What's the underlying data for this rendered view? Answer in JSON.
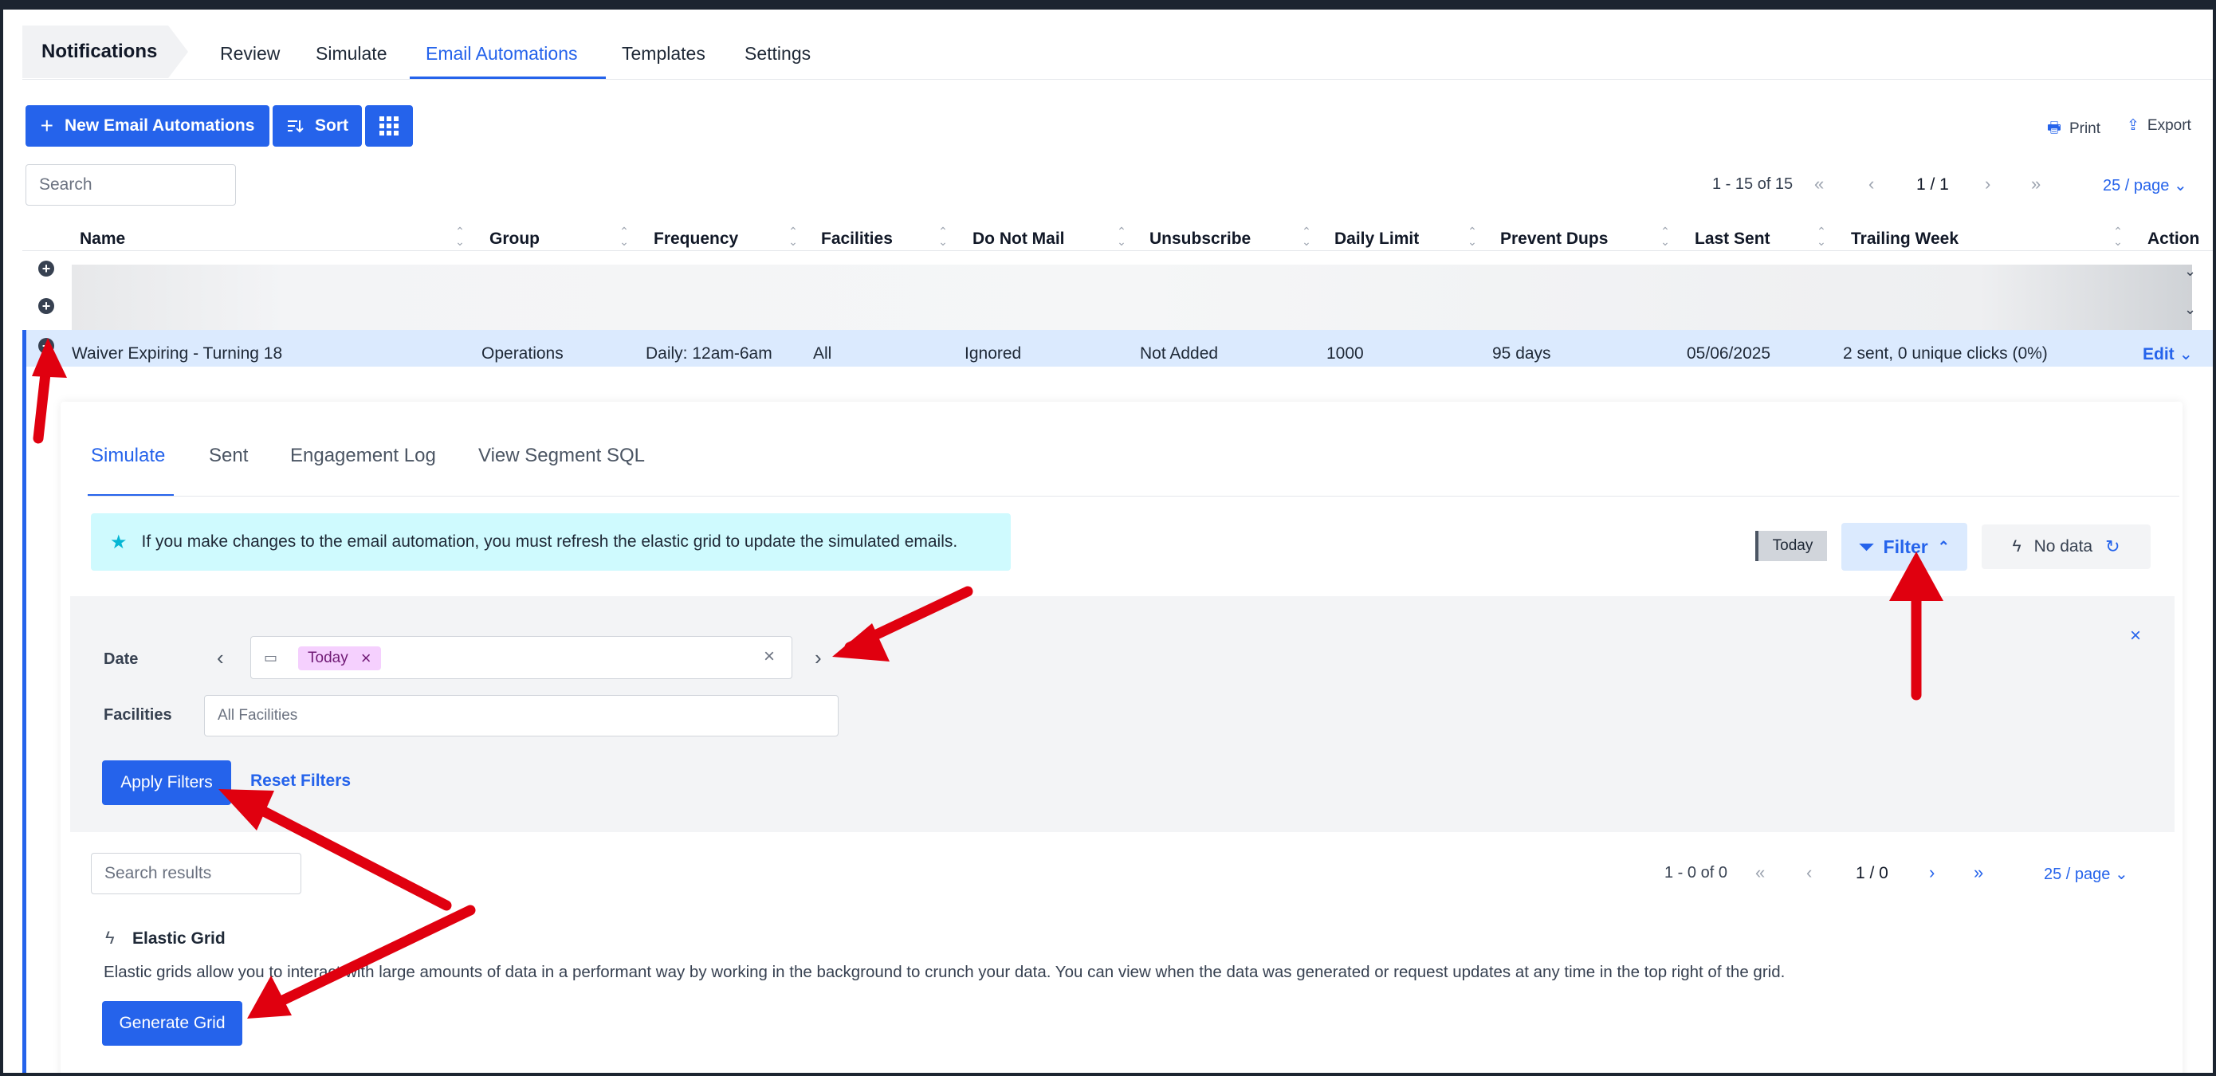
{
  "nav": {
    "breadcrumb": "Notifications",
    "tabs": [
      "Review",
      "Simulate",
      "Email Automations",
      "Templates",
      "Settings"
    ],
    "active_tab": "Email Automations"
  },
  "toolbar": {
    "new_label": "New Email Automations",
    "sort_label": "Sort",
    "print_label": "Print",
    "export_label": "Export"
  },
  "search": {
    "placeholder": "Search"
  },
  "pagination": {
    "range": "1 - 15 of 15",
    "page": "1 / 1",
    "per_page": "25 / page"
  },
  "table": {
    "headers": [
      "Name",
      "Group",
      "Frequency",
      "Facilities",
      "Do Not Mail",
      "Unsubscribe",
      "Daily Limit",
      "Prevent Dups",
      "Last Sent",
      "Trailing Week",
      "Action"
    ],
    "expanded_row": {
      "name": "Waiver Expiring - Turning 18",
      "group": "Operations",
      "frequency": "Daily: 12am-6am",
      "facilities": "All",
      "do_not_mail": "Ignored",
      "unsubscribe": "Not Added",
      "daily_limit": "1000",
      "prevent_dups": "95 days",
      "last_sent": "05/06/2025",
      "trailing_week": "2 sent, 0 unique clicks (0%)",
      "action": "Edit"
    }
  },
  "detail": {
    "tabs": [
      "Simulate",
      "Sent",
      "Engagement Log",
      "View Segment SQL"
    ],
    "active_tab": "Simulate",
    "banner": "If you make changes to the email automation, you must refresh the elastic grid to update the simulated emails.",
    "today_badge": "Today",
    "filter_label": "Filter",
    "no_data_label": "No data",
    "filters": {
      "date_label": "Date",
      "date_tag": "Today",
      "facilities_label": "Facilities",
      "facilities_placeholder": "All Facilities",
      "apply_label": "Apply Filters",
      "reset_label": "Reset Filters"
    },
    "results": {
      "search_placeholder": "Search results",
      "range": "1 - 0 of 0",
      "page": "1 / 0",
      "per_page": "25 / page"
    },
    "elastic": {
      "title": "Elastic Grid",
      "description": "Elastic grids allow you to interact with large amounts of data in a performant way by working in the background to crunch your data. You can view when the data was generated or request updates at any time in the top right of the grid.",
      "button_label": "Generate Grid"
    }
  },
  "colors": {
    "accent": "#2563eb",
    "annotation_arrow": "#e0000f",
    "banner_bg": "#cffafe",
    "tag_bg": "#f5d0fe"
  }
}
